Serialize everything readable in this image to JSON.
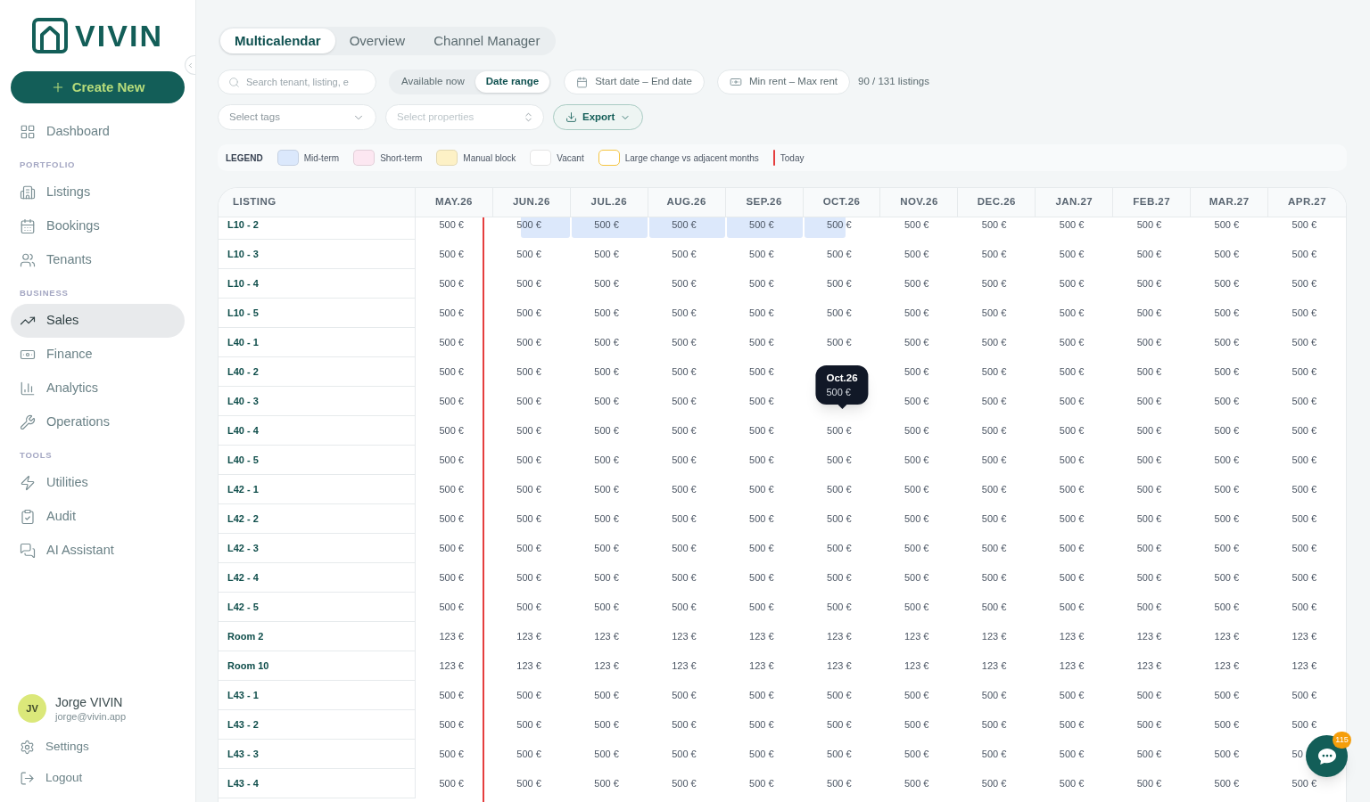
{
  "sidebar": {
    "logo": "VIVIN",
    "create_button": "Create New",
    "sections": [
      {
        "items": [
          {
            "label": "Dashboard",
            "selected": false
          }
        ]
      },
      {
        "title": "PORTFOLIO",
        "items": [
          {
            "label": "Listings",
            "selected": false
          },
          {
            "label": "Bookings",
            "selected": false
          },
          {
            "label": "Tenants",
            "selected": false
          }
        ]
      },
      {
        "title": "BUSINESS",
        "items": [
          {
            "label": "Sales",
            "selected": true
          },
          {
            "label": "Finance",
            "selected": false
          },
          {
            "label": "Analytics",
            "selected": false
          },
          {
            "label": "Operations",
            "selected": false
          }
        ]
      },
      {
        "title": "TOOLS",
        "items": [
          {
            "label": "Utilities",
            "selected": false
          },
          {
            "label": "Audit",
            "selected": false
          },
          {
            "label": "AI Assistant",
            "selected": false
          }
        ]
      }
    ],
    "user": {
      "initials": "JV",
      "name": "Jorge VIVIN",
      "email": "jorge@vivin.app"
    },
    "footer_links": [
      "Settings",
      "Logout"
    ]
  },
  "tabs": [
    {
      "label": "Multicalendar",
      "selected": true
    },
    {
      "label": "Overview",
      "selected": false
    },
    {
      "label": "Channel Manager",
      "selected": false
    }
  ],
  "filters": {
    "search": {
      "placeholder": "Search tenant, listing, e"
    },
    "availability": [
      {
        "label": "Available now",
        "selected": false
      },
      {
        "label": "Date range",
        "selected": true
      }
    ],
    "date_range": {
      "start_placeholder": "Start date",
      "separator": "–",
      "end_placeholder": "End date"
    },
    "rent_range": {
      "min_placeholder": "Min rent",
      "separator": "–",
      "max_placeholder": "Max rent"
    },
    "listing_count": "90 / 131 listings",
    "tags_select": {
      "placeholder": "Select tags"
    },
    "properties_select": {
      "placeholder": "Select properties"
    },
    "export_button": "Export"
  },
  "legend": {
    "title": "LEGEND",
    "items": [
      {
        "label": "Mid-term",
        "kind": "fill",
        "color": "#dbe8fc"
      },
      {
        "label": "Short-term",
        "kind": "fill",
        "color": "#fce7f1"
      },
      {
        "label": "Manual block",
        "kind": "fill",
        "color": "#fdf1c6"
      },
      {
        "label": "Vacant",
        "kind": "fill",
        "color": "#ffffff"
      },
      {
        "label": "Large change vs adjacent months",
        "kind": "outline",
        "color": "#f5c542"
      },
      {
        "label": "Today",
        "kind": "line",
        "color": "#e53e3e"
      }
    ]
  },
  "table": {
    "listing_header": "LISTING",
    "months": [
      {
        "label": "MAY.26",
        "today": true
      },
      {
        "label": "JUN.26",
        "today": false
      },
      {
        "label": "JUL.26",
        "today": false
      },
      {
        "label": "AUG.26",
        "today": false
      },
      {
        "label": "SEP.26",
        "today": false
      },
      {
        "label": "OCT.26",
        "today": false
      },
      {
        "label": "NOV.26",
        "today": false
      },
      {
        "label": "DEC.26",
        "today": false
      },
      {
        "label": "JAN.27",
        "today": false
      },
      {
        "label": "FEB.27",
        "today": false
      },
      {
        "label": "MAR.27",
        "today": false
      },
      {
        "label": "APR.27",
        "today": false
      }
    ],
    "rows": [
      {
        "name": "L10 - 2",
        "cells": [
          {
            "kind": "vacant",
            "value": "500 €"
          },
          {
            "kind": "booking_start",
            "color": "#dce8fb",
            "value": "500 €"
          },
          {
            "kind": "booking",
            "color": "#dce8fb",
            "value": "500 €"
          },
          {
            "kind": "booking",
            "color": "#dce8fb",
            "value": "500 €"
          },
          {
            "kind": "booking",
            "color": "#dce8fb",
            "value": "500 €"
          },
          {
            "kind": "booking_end",
            "color": "#dce8fb",
            "value": "500 €"
          },
          {
            "kind": "vacant",
            "value": "500 €"
          },
          {
            "kind": "vacant",
            "value": "500 €"
          },
          {
            "kind": "vacant",
            "value": "500 €"
          },
          {
            "kind": "vacant",
            "value": "500 €"
          },
          {
            "kind": "vacant",
            "value": "500 €"
          },
          {
            "kind": "vacant",
            "value": "500 €"
          }
        ]
      },
      {
        "name": "L10 - 3",
        "cells": [
          {
            "kind": "vacant",
            "value": "500 €"
          },
          {
            "kind": "vacant",
            "value": "500 €"
          },
          {
            "kind": "vacant",
            "value": "500 €"
          },
          {
            "kind": "vacant",
            "value": "500 €"
          },
          {
            "kind": "vacant",
            "value": "500 €"
          },
          {
            "kind": "vacant",
            "value": "500 €"
          },
          {
            "kind": "vacant",
            "value": "500 €"
          },
          {
            "kind": "vacant",
            "value": "500 €"
          },
          {
            "kind": "vacant",
            "value": "500 €"
          },
          {
            "kind": "vacant",
            "value": "500 €"
          },
          {
            "kind": "vacant",
            "value": "500 €"
          },
          {
            "kind": "vacant",
            "value": "500 €"
          }
        ]
      },
      {
        "name": "L10 - 4",
        "cells": [
          {
            "kind": "vacant",
            "value": "500 €"
          },
          {
            "kind": "vacant",
            "value": "500 €"
          },
          {
            "kind": "vacant",
            "value": "500 €"
          },
          {
            "kind": "vacant",
            "value": "500 €"
          },
          {
            "kind": "vacant",
            "value": "500 €"
          },
          {
            "kind": "vacant",
            "value": "500 €"
          },
          {
            "kind": "vacant",
            "value": "500 €"
          },
          {
            "kind": "vacant",
            "value": "500 €"
          },
          {
            "kind": "vacant",
            "value": "500 €"
          },
          {
            "kind": "vacant",
            "value": "500 €"
          },
          {
            "kind": "vacant",
            "value": "500 €"
          },
          {
            "kind": "vacant",
            "value": "500 €"
          }
        ]
      },
      {
        "name": "L10 - 5",
        "cells": [
          {
            "kind": "vacant",
            "value": "500 €"
          },
          {
            "kind": "vacant",
            "value": "500 €"
          },
          {
            "kind": "vacant",
            "value": "500 €"
          },
          {
            "kind": "vacant",
            "value": "500 €"
          },
          {
            "kind": "vacant",
            "value": "500 €"
          },
          {
            "kind": "vacant",
            "value": "500 €"
          },
          {
            "kind": "vacant",
            "value": "500 €"
          },
          {
            "kind": "vacant",
            "value": "500 €"
          },
          {
            "kind": "vacant",
            "value": "500 €"
          },
          {
            "kind": "vacant",
            "value": "500 €"
          },
          {
            "kind": "vacant",
            "value": "500 €"
          },
          {
            "kind": "vacant",
            "value": "500 €"
          }
        ]
      },
      {
        "name": "L40 - 1",
        "cells": [
          {
            "kind": "vacant",
            "value": "500 €"
          },
          {
            "kind": "vacant",
            "value": "500 €"
          },
          {
            "kind": "vacant",
            "value": "500 €"
          },
          {
            "kind": "vacant",
            "value": "500 €"
          },
          {
            "kind": "vacant",
            "value": "500 €"
          },
          {
            "kind": "vacant",
            "value": "500 €"
          },
          {
            "kind": "vacant",
            "value": "500 €"
          },
          {
            "kind": "vacant",
            "value": "500 €"
          },
          {
            "kind": "vacant",
            "value": "500 €"
          },
          {
            "kind": "vacant",
            "value": "500 €"
          },
          {
            "kind": "vacant",
            "value": "500 €"
          },
          {
            "kind": "vacant",
            "value": "500 €"
          }
        ]
      },
      {
        "name": "L40 - 2",
        "cells": [
          {
            "kind": "vacant",
            "value": "500 €"
          },
          {
            "kind": "vacant",
            "value": "500 €"
          },
          {
            "kind": "vacant",
            "value": "500 €"
          },
          {
            "kind": "vacant",
            "value": "500 €"
          },
          {
            "kind": "vacant",
            "value": "500 €"
          },
          {
            "kind": "vacant"
          },
          {
            "kind": "vacant",
            "value": "500 €"
          },
          {
            "kind": "vacant",
            "value": "500 €"
          },
          {
            "kind": "vacant",
            "value": "500 €"
          },
          {
            "kind": "vacant",
            "value": "500 €"
          },
          {
            "kind": "vacant",
            "value": "500 €"
          },
          {
            "kind": "vacant",
            "value": "500 €"
          }
        ]
      },
      {
        "name": "L40 - 3",
        "cells": [
          {
            "kind": "vacant",
            "value": "500 €"
          },
          {
            "kind": "vacant",
            "value": "500 €"
          },
          {
            "kind": "vacant",
            "value": "500 €"
          },
          {
            "kind": "vacant",
            "value": "500 €"
          },
          {
            "kind": "vacant",
            "value": "500 €"
          },
          {
            "kind": "vacant"
          },
          {
            "kind": "vacant",
            "value": "500 €"
          },
          {
            "kind": "vacant",
            "value": "500 €"
          },
          {
            "kind": "vacant",
            "value": "500 €"
          },
          {
            "kind": "vacant",
            "value": "500 €"
          },
          {
            "kind": "vacant",
            "value": "500 €"
          },
          {
            "kind": "vacant",
            "value": "500 €"
          }
        ]
      },
      {
        "name": "L40 - 4",
        "cells": [
          {
            "kind": "vacant",
            "value": "500 €"
          },
          {
            "kind": "vacant",
            "value": "500 €"
          },
          {
            "kind": "vacant",
            "value": "500 €"
          },
          {
            "kind": "vacant",
            "value": "500 €"
          },
          {
            "kind": "vacant",
            "value": "500 €"
          },
          {
            "kind": "vacant",
            "value": "500 €",
            "tooltip": {
              "title": "Oct.26",
              "value": "500 €"
            }
          },
          {
            "kind": "vacant",
            "value": "500 €"
          },
          {
            "kind": "vacant",
            "value": "500 €"
          },
          {
            "kind": "vacant",
            "value": "500 €"
          },
          {
            "kind": "vacant",
            "value": "500 €"
          },
          {
            "kind": "vacant",
            "value": "500 €"
          },
          {
            "kind": "vacant",
            "value": "500 €"
          }
        ]
      },
      {
        "name": "L40 - 5",
        "cells": [
          {
            "kind": "vacant",
            "value": "500 €"
          },
          {
            "kind": "vacant",
            "value": "500 €"
          },
          {
            "kind": "vacant",
            "value": "500 €"
          },
          {
            "kind": "vacant",
            "value": "500 €"
          },
          {
            "kind": "vacant",
            "value": "500 €"
          },
          {
            "kind": "vacant",
            "value": "500 €"
          },
          {
            "kind": "vacant",
            "value": "500 €"
          },
          {
            "kind": "vacant",
            "value": "500 €"
          },
          {
            "kind": "vacant",
            "value": "500 €"
          },
          {
            "kind": "vacant",
            "value": "500 €"
          },
          {
            "kind": "vacant",
            "value": "500 €"
          },
          {
            "kind": "vacant",
            "value": "500 €"
          }
        ]
      },
      {
        "name": "L42 - 1",
        "cells": [
          {
            "kind": "vacant",
            "value": "500 €"
          },
          {
            "kind": "vacant",
            "value": "500 €"
          },
          {
            "kind": "vacant",
            "value": "500 €"
          },
          {
            "kind": "vacant",
            "value": "500 €"
          },
          {
            "kind": "vacant",
            "value": "500 €"
          },
          {
            "kind": "vacant",
            "value": "500 €"
          },
          {
            "kind": "vacant",
            "value": "500 €"
          },
          {
            "kind": "vacant",
            "value": "500 €"
          },
          {
            "kind": "vacant",
            "value": "500 €"
          },
          {
            "kind": "vacant",
            "value": "500 €"
          },
          {
            "kind": "vacant",
            "value": "500 €"
          },
          {
            "kind": "vacant",
            "value": "500 €"
          }
        ]
      },
      {
        "name": "L42 - 2",
        "cells": [
          {
            "kind": "vacant",
            "value": "500 €"
          },
          {
            "kind": "vacant",
            "value": "500 €"
          },
          {
            "kind": "vacant",
            "value": "500 €"
          },
          {
            "kind": "vacant",
            "value": "500 €"
          },
          {
            "kind": "vacant",
            "value": "500 €"
          },
          {
            "kind": "vacant",
            "value": "500 €"
          },
          {
            "kind": "vacant",
            "value": "500 €"
          },
          {
            "kind": "vacant",
            "value": "500 €"
          },
          {
            "kind": "vacant",
            "value": "500 €"
          },
          {
            "kind": "vacant",
            "value": "500 €"
          },
          {
            "kind": "vacant",
            "value": "500 €"
          },
          {
            "kind": "vacant",
            "value": "500 €"
          }
        ]
      },
      {
        "name": "L42 - 3",
        "cells": [
          {
            "kind": "vacant",
            "value": "500 €"
          },
          {
            "kind": "vacant",
            "value": "500 €"
          },
          {
            "kind": "vacant",
            "value": "500 €"
          },
          {
            "kind": "vacant",
            "value": "500 €"
          },
          {
            "kind": "vacant",
            "value": "500 €"
          },
          {
            "kind": "vacant",
            "value": "500 €"
          },
          {
            "kind": "vacant",
            "value": "500 €"
          },
          {
            "kind": "vacant",
            "value": "500 €"
          },
          {
            "kind": "vacant",
            "value": "500 €"
          },
          {
            "kind": "vacant",
            "value": "500 €"
          },
          {
            "kind": "vacant",
            "value": "500 €"
          },
          {
            "kind": "vacant",
            "value": "500 €"
          }
        ]
      },
      {
        "name": "L42 - 4",
        "cells": [
          {
            "kind": "vacant",
            "value": "500 €"
          },
          {
            "kind": "vacant",
            "value": "500 €"
          },
          {
            "kind": "vacant",
            "value": "500 €"
          },
          {
            "kind": "vacant",
            "value": "500 €"
          },
          {
            "kind": "vacant",
            "value": "500 €"
          },
          {
            "kind": "vacant",
            "value": "500 €"
          },
          {
            "kind": "vacant",
            "value": "500 €"
          },
          {
            "kind": "vacant",
            "value": "500 €"
          },
          {
            "kind": "vacant",
            "value": "500 €"
          },
          {
            "kind": "vacant",
            "value": "500 €"
          },
          {
            "kind": "vacant",
            "value": "500 €"
          },
          {
            "kind": "vacant",
            "value": "500 €"
          }
        ]
      },
      {
        "name": "L42 - 5",
        "cells": [
          {
            "kind": "vacant",
            "value": "500 €"
          },
          {
            "kind": "vacant",
            "value": "500 €"
          },
          {
            "kind": "vacant",
            "value": "500 €"
          },
          {
            "kind": "vacant",
            "value": "500 €"
          },
          {
            "kind": "vacant",
            "value": "500 €"
          },
          {
            "kind": "vacant",
            "value": "500 €"
          },
          {
            "kind": "vacant",
            "value": "500 €"
          },
          {
            "kind": "vacant",
            "value": "500 €"
          },
          {
            "kind": "vacant",
            "value": "500 €"
          },
          {
            "kind": "vacant",
            "value": "500 €"
          },
          {
            "kind": "vacant",
            "value": "500 €"
          },
          {
            "kind": "vacant",
            "value": "500 €"
          }
        ]
      },
      {
        "name": "Room 2",
        "cells": [
          {
            "kind": "vacant",
            "value": "123 €"
          },
          {
            "kind": "vacant",
            "value": "123 €"
          },
          {
            "kind": "vacant",
            "value": "123 €"
          },
          {
            "kind": "vacant",
            "value": "123 €"
          },
          {
            "kind": "vacant",
            "value": "123 €"
          },
          {
            "kind": "vacant",
            "value": "123 €"
          },
          {
            "kind": "vacant",
            "value": "123 €"
          },
          {
            "kind": "vacant",
            "value": "123 €"
          },
          {
            "kind": "vacant",
            "value": "123 €"
          },
          {
            "kind": "vacant",
            "value": "123 €"
          },
          {
            "kind": "vacant",
            "value": "123 €"
          },
          {
            "kind": "vacant",
            "value": "123 €"
          }
        ]
      },
      {
        "name": "Room 10",
        "cells": [
          {
            "kind": "vacant",
            "value": "123 €"
          },
          {
            "kind": "vacant",
            "value": "123 €"
          },
          {
            "kind": "vacant",
            "value": "123 €"
          },
          {
            "kind": "vacant",
            "value": "123 €"
          },
          {
            "kind": "vacant",
            "value": "123 €"
          },
          {
            "kind": "vacant",
            "value": "123 €"
          },
          {
            "kind": "vacant",
            "value": "123 €"
          },
          {
            "kind": "vacant",
            "value": "123 €"
          },
          {
            "kind": "vacant",
            "value": "123 €"
          },
          {
            "kind": "vacant",
            "value": "123 €"
          },
          {
            "kind": "vacant",
            "value": "123 €"
          },
          {
            "kind": "vacant",
            "value": "123 €"
          }
        ]
      },
      {
        "name": "L43 - 1",
        "cells": [
          {
            "kind": "vacant",
            "value": "500 €"
          },
          {
            "kind": "vacant",
            "value": "500 €"
          },
          {
            "kind": "vacant",
            "value": "500 €"
          },
          {
            "kind": "vacant",
            "value": "500 €"
          },
          {
            "kind": "vacant",
            "value": "500 €"
          },
          {
            "kind": "vacant",
            "value": "500 €"
          },
          {
            "kind": "vacant",
            "value": "500 €"
          },
          {
            "kind": "vacant",
            "value": "500 €"
          },
          {
            "kind": "vacant",
            "value": "500 €"
          },
          {
            "kind": "vacant",
            "value": "500 €"
          },
          {
            "kind": "vacant",
            "value": "500 €"
          },
          {
            "kind": "vacant",
            "value": "500 €"
          }
        ]
      },
      {
        "name": "L43 - 2",
        "cells": [
          {
            "kind": "vacant",
            "value": "500 €"
          },
          {
            "kind": "vacant",
            "value": "500 €"
          },
          {
            "kind": "vacant",
            "value": "500 €"
          },
          {
            "kind": "vacant",
            "value": "500 €"
          },
          {
            "kind": "vacant",
            "value": "500 €"
          },
          {
            "kind": "vacant",
            "value": "500 €"
          },
          {
            "kind": "vacant",
            "value": "500 €"
          },
          {
            "kind": "vacant",
            "value": "500 €"
          },
          {
            "kind": "vacant",
            "value": "500 €"
          },
          {
            "kind": "vacant",
            "value": "500 €"
          },
          {
            "kind": "vacant",
            "value": "500 €"
          },
          {
            "kind": "vacant",
            "value": "500 €"
          }
        ]
      },
      {
        "name": "L43 - 3",
        "cells": [
          {
            "kind": "vacant",
            "value": "500 €"
          },
          {
            "kind": "vacant",
            "value": "500 €"
          },
          {
            "kind": "vacant",
            "value": "500 €"
          },
          {
            "kind": "vacant",
            "value": "500 €"
          },
          {
            "kind": "vacant",
            "value": "500 €"
          },
          {
            "kind": "vacant",
            "value": "500 €"
          },
          {
            "kind": "vacant",
            "value": "500 €"
          },
          {
            "kind": "vacant",
            "value": "500 €"
          },
          {
            "kind": "vacant",
            "value": "500 €"
          },
          {
            "kind": "vacant",
            "value": "500 €"
          },
          {
            "kind": "vacant",
            "value": "500 €"
          },
          {
            "kind": "vacant",
            "value": "50"
          }
        ]
      },
      {
        "name": "L43 - 4",
        "cells": [
          {
            "kind": "vacant",
            "value": "500 €"
          },
          {
            "kind": "vacant",
            "value": "500 €"
          },
          {
            "kind": "vacant",
            "value": "500 €"
          },
          {
            "kind": "vacant",
            "value": "500 €"
          },
          {
            "kind": "vacant",
            "value": "500 €"
          },
          {
            "kind": "vacant",
            "value": "500 €"
          },
          {
            "kind": "vacant",
            "value": "500 €"
          },
          {
            "kind": "vacant",
            "value": "500 €"
          },
          {
            "kind": "vacant",
            "value": "500 €"
          },
          {
            "kind": "vacant",
            "value": "500 €"
          },
          {
            "kind": "vacant",
            "value": "500 €"
          },
          {
            "kind": "vacant",
            "value": "500 €"
          }
        ]
      }
    ]
  },
  "chat": {
    "badge": "115"
  }
}
